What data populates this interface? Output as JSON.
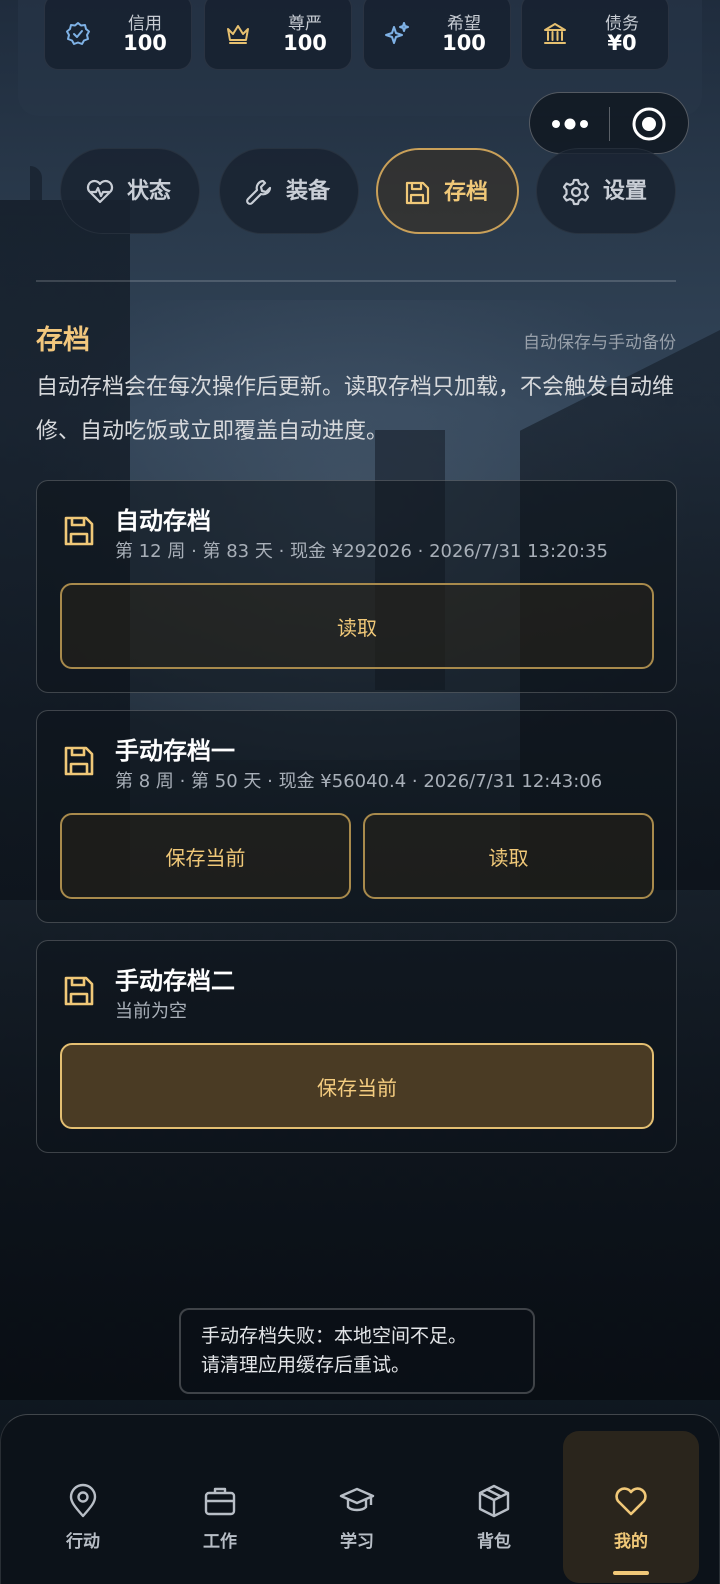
{
  "colors": {
    "accent_gold": "#f0c878",
    "card_border": "#a88a4c",
    "stat_icon_blue": "#7fb2e6",
    "stat_icon_gold": "#e6c070"
  },
  "stats": [
    {
      "label": "信用",
      "value": "100",
      "icon": "badge-check-icon"
    },
    {
      "label": "尊严",
      "value": "100",
      "icon": "crown-icon"
    },
    {
      "label": "希望",
      "value": "100",
      "icon": "sparkles-icon"
    },
    {
      "label": "债务",
      "value": "¥0",
      "icon": "bank-icon"
    }
  ],
  "tabs": [
    {
      "label": "状态",
      "icon": "heart-pulse-icon"
    },
    {
      "label": "装备",
      "icon": "wrench-icon"
    },
    {
      "label": "存档",
      "icon": "floppy-disk-icon",
      "active": true
    },
    {
      "label": "设置",
      "icon": "gear-icon"
    }
  ],
  "section": {
    "title": "存档",
    "subtitle": "自动保存与手动备份",
    "description": "自动存档会在每次操作后更新。读取存档只加载，不会触发自动维修、自动吃饭或立即覆盖自动进度。"
  },
  "saves": {
    "auto": {
      "name": "自动存档",
      "meta": "第 12 周 · 第 83 天 · 现金 ¥292026 · 2026/7/31 13:20:35",
      "load_label": "读取"
    },
    "manual1": {
      "name": "手动存档一",
      "meta": "第 8 周 · 第 50 天 · 现金 ¥56040.4 · 2026/7/31 12:43:06",
      "save_label": "保存当前",
      "load_label": "读取"
    },
    "manual2": {
      "name": "手动存档二",
      "meta": "当前为空",
      "save_label": "保存当前"
    }
  },
  "toast": {
    "line1": "手动存档失败：本地空间不足。",
    "line2": "请清理应用缓存后重试。"
  },
  "nav": [
    {
      "label": "行动",
      "icon": "location-pin-icon"
    },
    {
      "label": "工作",
      "icon": "briefcase-icon"
    },
    {
      "label": "学习",
      "icon": "graduation-cap-icon"
    },
    {
      "label": "背包",
      "icon": "box-icon"
    },
    {
      "label": "我的",
      "icon": "heart-icon",
      "active": true
    }
  ]
}
